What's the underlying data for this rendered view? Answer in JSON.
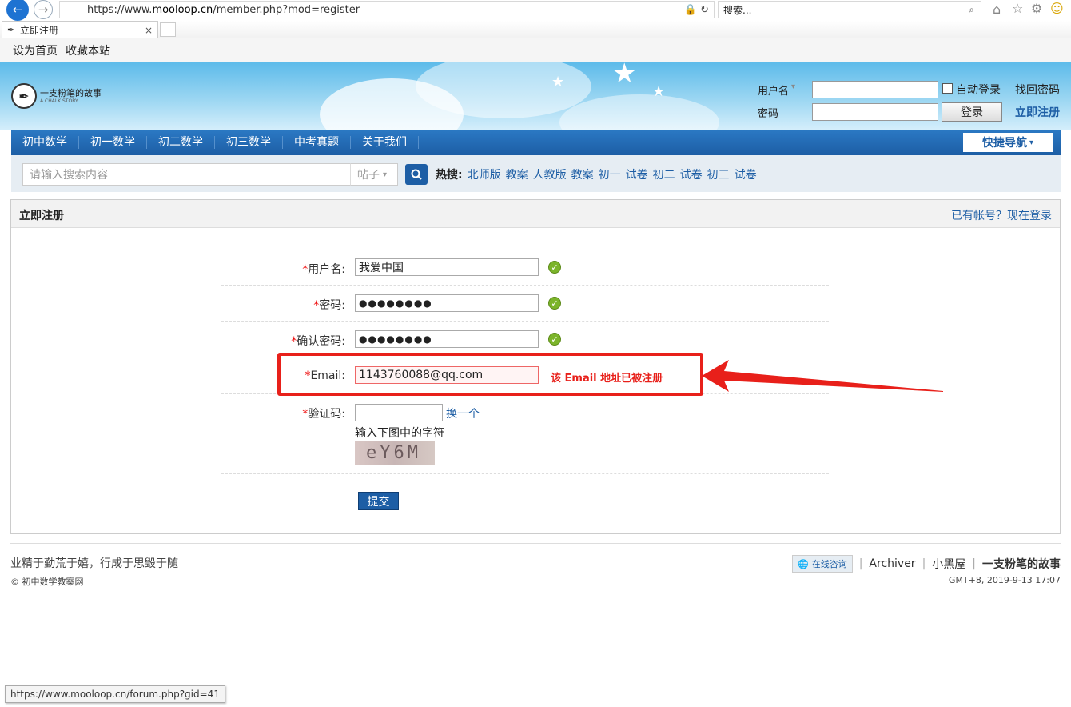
{
  "browser": {
    "url_scheme": "https://www.",
    "url_domain": "mooloop.cn",
    "url_path": "/member.php?mod=register",
    "search_placeholder": "搜索...",
    "tab_title": "立即注册",
    "tab_close": "×",
    "favorites": [
      "设为首页",
      "收藏本站"
    ],
    "status_url": "https://www.mooloop.cn/forum.php?gid=41"
  },
  "header": {
    "logo_text": "一支粉笔的故事",
    "logo_sub": "A CHALK STORY",
    "username_label": "用户名",
    "password_label": "密码",
    "autologin_label": "自动登录",
    "forgot_password": "找回密码",
    "login_button": "登录",
    "register_link": "立即注册"
  },
  "nav": {
    "items": [
      "初中数学",
      "初一数学",
      "初二数学",
      "初三数学",
      "中考真题",
      "关于我们"
    ],
    "quick_nav": "快捷导航"
  },
  "search": {
    "placeholder": "请输入搜索内容",
    "type": "帖子",
    "hot_label": "热搜:",
    "hot_items": [
      "北师版",
      "教案",
      "人教版",
      "教案",
      "初一",
      "试卷",
      "初二",
      "试卷",
      "初三",
      "试卷"
    ]
  },
  "register": {
    "title": "立即注册",
    "have_account": "已有帐号？现在登录",
    "required_mark": "*",
    "username_label": "用户名:",
    "username_value": "我爱中国",
    "password_label": "密码:",
    "password_value": "●●●●●●●●",
    "confirm_label": "确认密码:",
    "confirm_value": "●●●●●●●●",
    "email_label": "Email:",
    "email_value": "1143760088@qq.com",
    "email_error": "该 Email 地址已被注册",
    "captcha_label": "验证码:",
    "captcha_refresh": "换一个",
    "captcha_hint": "输入下图中的字符",
    "captcha_image_text": "eY6M",
    "submit_label": "提交",
    "ok_mark": "✓"
  },
  "footer": {
    "motto": "业精于勤荒于嬉，行成于思毁于随",
    "copyright": "© 初中数学教案网",
    "consult": "在线咨询",
    "archiver": "Archiver",
    "blackroom": "小黑屋",
    "site": "一支粉笔的故事",
    "time": "GMT+8, 2019-9-13 17:07"
  },
  "colors": {
    "accent": "#1d5ea5",
    "error": "#e8201a"
  }
}
